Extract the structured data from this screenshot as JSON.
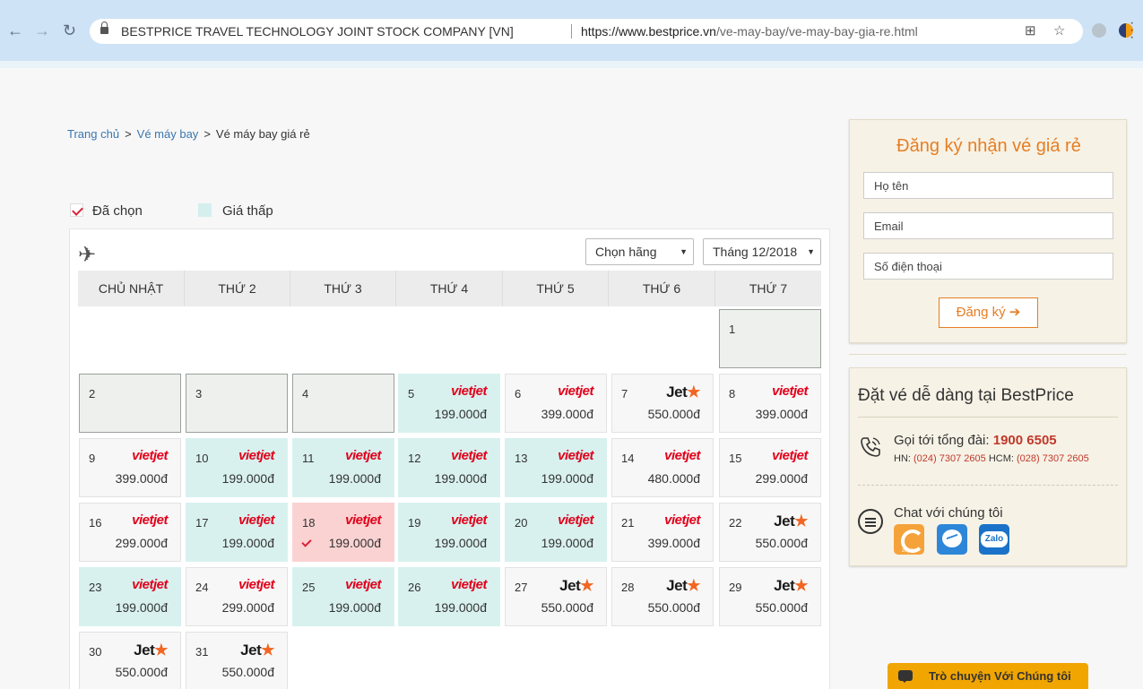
{
  "browser": {
    "site_identity": "BESTPRICE TRAVEL TECHNOLOGY JOINT STOCK COMPANY [VN]",
    "url_host": "https://www.bestprice.vn",
    "url_path": "/ve-may-bay/ve-may-bay-gia-re.html",
    "back_icon": "←",
    "forward_icon": "→",
    "reload_icon": "↻",
    "translate_icon": "⊞",
    "star_icon": "☆"
  },
  "breadcrumb": {
    "home": "Trang chủ",
    "section": "Vé máy bay",
    "current": "Vé máy bay giá rẻ",
    "separator": ">"
  },
  "legend": {
    "selected": "Đã chọn",
    "low_price": "Giá thấp",
    "selected_color": "#d9233a",
    "low_price_color": "#d5eeee"
  },
  "calendar": {
    "airline_select": "Chọn hãng",
    "month_select": "Tháng 12/2018",
    "plane_icon": "✈",
    "weekdays": [
      "CHỦ NHẬT",
      "THỨ 2",
      "THỨ 3",
      "THỨ 4",
      "THỨ 5",
      "THỨ 6",
      "THỨ 7"
    ],
    "days": [
      {
        "day": "1",
        "airline": "",
        "price": "",
        "state": "empty"
      },
      {
        "day": "2",
        "airline": "",
        "price": "",
        "state": "empty"
      },
      {
        "day": "3",
        "airline": "",
        "price": "",
        "state": "empty"
      },
      {
        "day": "4",
        "airline": "",
        "price": "",
        "state": "empty"
      },
      {
        "day": "5",
        "airline": "vietjet",
        "price": "199.000đ",
        "state": "low"
      },
      {
        "day": "6",
        "airline": "vietjet",
        "price": "399.000đ",
        "state": "normal"
      },
      {
        "day": "7",
        "airline": "jetstar",
        "price": "550.000đ",
        "state": "normal"
      },
      {
        "day": "8",
        "airline": "vietjet",
        "price": "399.000đ",
        "state": "normal"
      },
      {
        "day": "9",
        "airline": "vietjet",
        "price": "399.000đ",
        "state": "normal"
      },
      {
        "day": "10",
        "airline": "vietjet",
        "price": "199.000đ",
        "state": "low"
      },
      {
        "day": "11",
        "airline": "vietjet",
        "price": "199.000đ",
        "state": "low"
      },
      {
        "day": "12",
        "airline": "vietjet",
        "price": "199.000đ",
        "state": "low"
      },
      {
        "day": "13",
        "airline": "vietjet",
        "price": "199.000đ",
        "state": "low"
      },
      {
        "day": "14",
        "airline": "vietjet",
        "price": "480.000đ",
        "state": "normal"
      },
      {
        "day": "15",
        "airline": "vietjet",
        "price": "299.000đ",
        "state": "normal"
      },
      {
        "day": "16",
        "airline": "vietjet",
        "price": "299.000đ",
        "state": "normal"
      },
      {
        "day": "17",
        "airline": "vietjet",
        "price": "199.000đ",
        "state": "low"
      },
      {
        "day": "18",
        "airline": "vietjet",
        "price": "199.000đ",
        "state": "selected"
      },
      {
        "day": "19",
        "airline": "vietjet",
        "price": "199.000đ",
        "state": "low"
      },
      {
        "day": "20",
        "airline": "vietjet",
        "price": "199.000đ",
        "state": "low"
      },
      {
        "day": "21",
        "airline": "vietjet",
        "price": "399.000đ",
        "state": "normal"
      },
      {
        "day": "22",
        "airline": "jetstar",
        "price": "550.000đ",
        "state": "normal"
      },
      {
        "day": "23",
        "airline": "vietjet",
        "price": "199.000đ",
        "state": "low"
      },
      {
        "day": "24",
        "airline": "vietjet",
        "price": "299.000đ",
        "state": "normal"
      },
      {
        "day": "25",
        "airline": "vietjet",
        "price": "199.000đ",
        "state": "low"
      },
      {
        "day": "26",
        "airline": "vietjet",
        "price": "199.000đ",
        "state": "low"
      },
      {
        "day": "27",
        "airline": "jetstar",
        "price": "550.000đ",
        "state": "normal"
      },
      {
        "day": "28",
        "airline": "jetstar",
        "price": "550.000đ",
        "state": "normal"
      },
      {
        "day": "29",
        "airline": "jetstar",
        "price": "550.000đ",
        "state": "normal"
      },
      {
        "day": "30",
        "airline": "jetstar",
        "price": "550.000đ",
        "state": "normal"
      },
      {
        "day": "31",
        "airline": "jetstar",
        "price": "550.000đ",
        "state": "normal"
      }
    ],
    "logos": {
      "vietjet": "vietjet",
      "jetstar_text": "Jet",
      "jetstar_star": "★"
    }
  },
  "signup": {
    "title": "Đăng ký nhận vé giá rẻ",
    "name_placeholder": "Họ tên",
    "email_placeholder": "Email",
    "phone_placeholder": "Số điện thoại",
    "button": "Đăng ký ➔"
  },
  "contact": {
    "title": "Đặt vé dễ dàng tại BestPrice",
    "call_label": "Gọi tới tổng đài:",
    "hotline": "1900 6505",
    "hn_label": "HN:",
    "hn_number": "(024) 7307 2605",
    "hcm_label": "HCM:",
    "hcm_number": "(028) 7307 2605",
    "chat_label": "Chat với chúng tôi",
    "zopim_label": "zopim",
    "zalo_label": "Zalo"
  },
  "chat_bar": {
    "label": "Trò chuyện Với Chúng tôi"
  }
}
